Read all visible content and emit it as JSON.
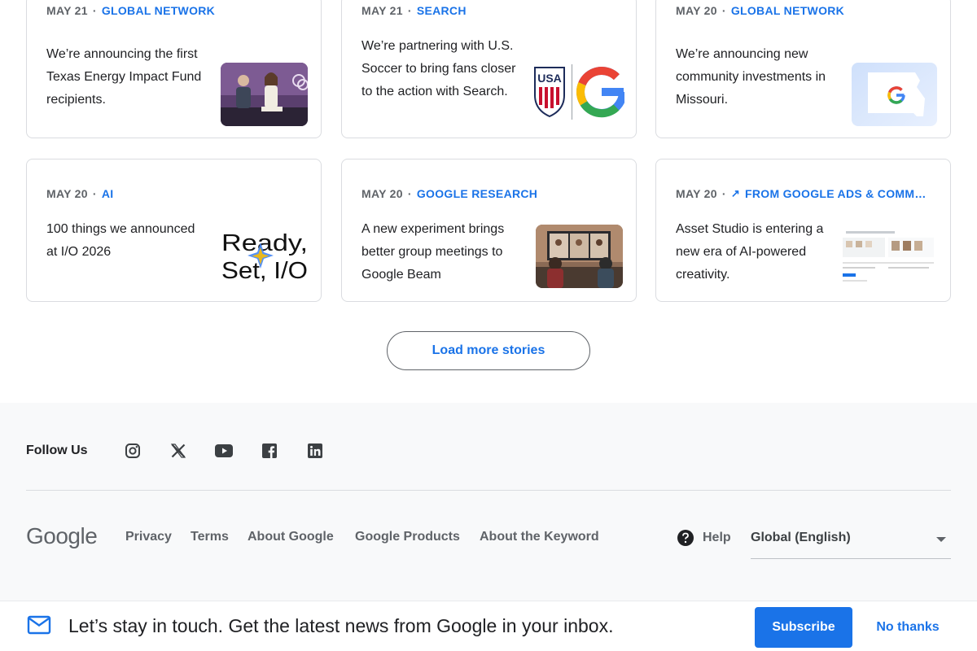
{
  "cards": [
    {
      "date": "MAY 21",
      "category": "GLOBAL NETWORK",
      "title": "We’re announcing the first Texas Energy Impact Fund recipients.",
      "thumb": "panel-discussion-photo"
    },
    {
      "date": "MAY 21",
      "category": "SEARCH",
      "title": "We’re partnering with U.S. Soccer to bring fans closer to the action with Search.",
      "thumb": "usa-soccer-google-logos"
    },
    {
      "date": "MAY 20",
      "category": "GLOBAL NETWORK",
      "title": "We’re announcing new community investments in Missouri.",
      "thumb": "missouri-google-map"
    },
    {
      "date": "MAY 20",
      "category": "AI",
      "title": "100 things we announced at I/O 2026",
      "thumb": "ready-set-io-graphic",
      "thumb_text": "Ready, Set, I/O"
    },
    {
      "date": "MAY 20",
      "category": "GOOGLE RESEARCH",
      "title": "A new experiment brings better group meetings to Google Beam",
      "thumb": "video-meeting-photo"
    },
    {
      "date": "MAY 20",
      "category": "FROM GOOGLE ADS & COMMER...",
      "title": "Asset Studio is entering a new era of AI-powered creativity.",
      "thumb": "asset-studio-screenshot",
      "external": true
    }
  ],
  "load_more": "Load more stories",
  "footer": {
    "follow_us": "Follow Us",
    "social": [
      "instagram-icon",
      "x-icon",
      "youtube-icon",
      "facebook-icon",
      "linkedin-icon"
    ],
    "logo": "Google",
    "links": [
      "Privacy",
      "Terms",
      "About Google",
      "Google Products",
      "About the Keyword"
    ],
    "help": "Help",
    "language": "Global (English)"
  },
  "banner": {
    "text": "Let’s stay in touch. Get the latest news from Google in your inbox.",
    "subscribe": "Subscribe",
    "no_thanks": "No thanks"
  },
  "colors": {
    "accent": "#1a73e8",
    "muted": "#5f6368",
    "footer_bg": "#f8f9fa"
  }
}
